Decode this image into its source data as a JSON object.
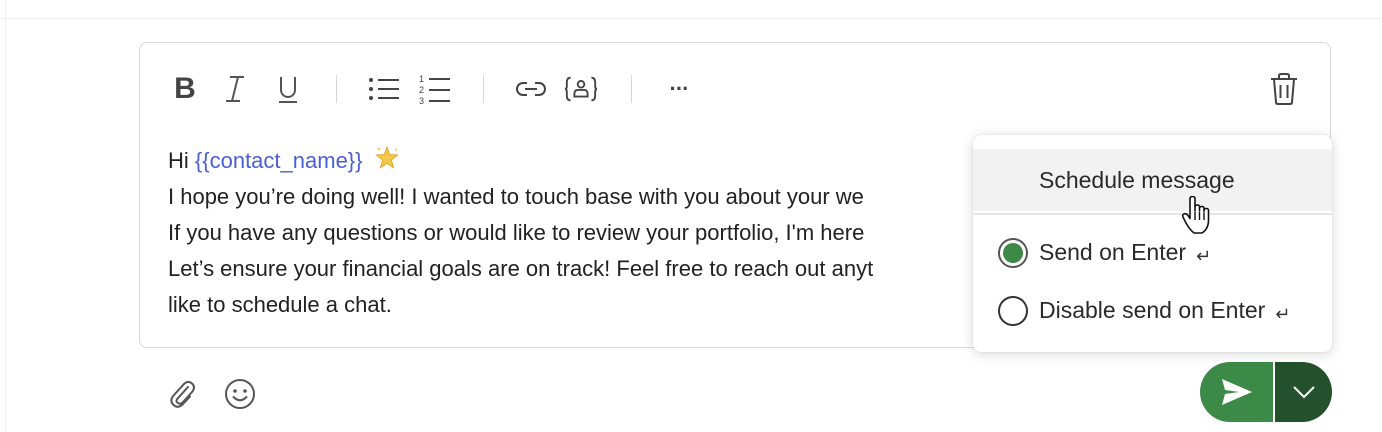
{
  "editor": {
    "greeting": "Hi",
    "variable": "{{contact_name}}",
    "emoji_name": "sparkle-star-icon",
    "lines": [
      "I hope you’re doing well! I wanted to touch base with you about your we",
      "If you have any questions or would like to review your portfolio, I'm here",
      "Let’s ensure your financial goals are on track! Feel free to reach out anyt",
      "like to schedule a chat."
    ]
  },
  "toolbar": {
    "bold": "B",
    "more": "···"
  },
  "dropdown": {
    "schedule_label": "Schedule message",
    "send_on_enter_label": "Send on Enter",
    "disable_send_on_enter_label": "Disable send on Enter",
    "enter_glyph": "↵",
    "selected_option": "Send on Enter"
  },
  "colors": {
    "send_button": "#3d8a48",
    "send_menu": "#24502b",
    "variable_text": "#4a5fd8",
    "radio_checked": "#3d8a48"
  }
}
